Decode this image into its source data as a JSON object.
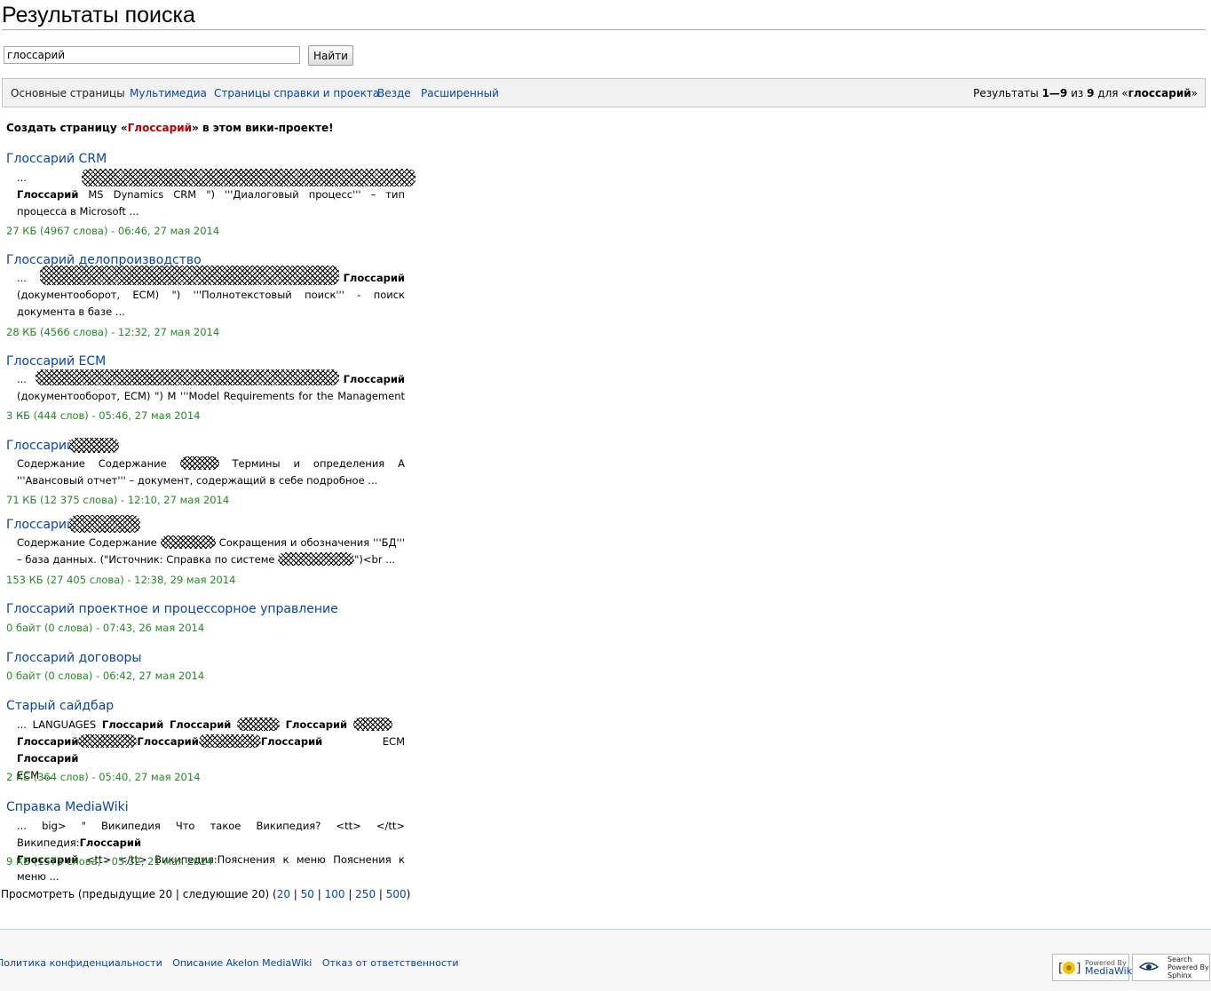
{
  "page": {
    "title": "Результаты поиска"
  },
  "search": {
    "value": "глоссарий",
    "button": "Найти"
  },
  "tabs": {
    "items": [
      "Основные страницы",
      "Мультимедиа",
      "Страницы справки и проекта",
      "Везде",
      "Расширенный"
    ],
    "info_prefix": "Результаты ",
    "info_range": "1—9",
    "info_mid": " из ",
    "info_total": "9",
    "info_for": " для «",
    "info_term": "глоссарий",
    "info_end": "»"
  },
  "create": {
    "prefix": "Создать страницу «",
    "link": "Глоссарий",
    "suffix": "» в этом вики-проекте!"
  },
  "results": [
    {
      "title": "Глоссарий CRM",
      "s1": "...",
      "s2_bold": "Глоссарий",
      "s2": " MS Dynamics CRM \") '''Диалоговый процесс''' – тип процесса в Microsoft ...",
      "meta": "27 КБ (4967 слова) - 06:46, 27 мая 2014"
    },
    {
      "title": "Глоссарий делопроизводство",
      "s1": "...",
      "s1_bold": "Глоссарий",
      "s2": "(документооборот, ECM) \") '''Полнотекстовый поиск''' - поиск документа в базе ...",
      "meta": "28 КБ (4566 слова) - 12:32, 27 мая 2014"
    },
    {
      "title": "Глоссарий ECM",
      "s1": "...",
      "s1_bold": "Глоссарий",
      "s2": "(документооборот, ECM) \") M '''Model Requirements for the Management ...",
      "meta": "3 КБ (444 слов) - 05:46, 27 мая 2014"
    },
    {
      "title": "Глоссарий",
      "s1a": "Содержание Содержание ",
      "s1b": " Термины и определения А '''Авансовый отчет''' – документ, содержащий в себе подробное ...",
      "meta": "71 КБ (12 375 слова) - 12:10, 27 мая 2014"
    },
    {
      "title": "Глоссарий",
      "s1a": "Содержание Содержание ",
      "s1b": " Сокращения и обозначения '''БД''' – база данных. (\"Источник: Справка по системе ",
      "s1c": "\")<br ...",
      "meta": "153 КБ (27 405 слова) - 12:38, 29 мая 2014"
    },
    {
      "title": "Глоссарий проектное и процессорное управление",
      "meta": "0 байт (0 слова) - 07:43, 26 мая 2014"
    },
    {
      "title": "Глоссарий договоры",
      "meta": "0 байт (0 слова) - 06:42, 27 мая 2014"
    },
    {
      "title": "Старый сайдбар",
      "s1": "... LANGUAGES ",
      "b1": "Глоссарий",
      "b2": "Глоссарий",
      "b3": "Глоссарий",
      "b4": "Глоссарий",
      "b5": "Глоссарий",
      "b6": "Глоссарий",
      "t_ecm": " ECM ",
      "b7": "Глоссарий",
      "tail": " ECM ...",
      "meta": "2 КБ (364 слов) - 05:40, 27 мая 2014"
    },
    {
      "title": "Справка MediaWiki",
      "s1": "... big> \" Википедия Что такое Википедия? <tt> </tt> Википедия:",
      "b1": "Глоссарий",
      "b2": "Глоссарий",
      "s2": " <tt> </tt> Википедия:Пояснения к меню Пояснения к меню ...",
      "meta": "9 КБ (1575 слова) - 05:32, 21 мая 2014"
    }
  ],
  "pager": {
    "prefix": "Просмотреть (предыдущие 20 | следующие 20) (",
    "options": [
      "20",
      "50",
      "100",
      "250",
      "500"
    ],
    "sep": " | ",
    "suffix": ")"
  },
  "footer": {
    "links": [
      "Политика конфиденциальности",
      "Описание Akelon MediaWiki",
      "Отказ от ответственности"
    ],
    "badge_mw_top": "Powered By",
    "badge_mw_main": "MediaWiki",
    "badge_sphinx": [
      "Search",
      "Powered By",
      "Sphinx"
    ]
  },
  "colors": {
    "link": "#0645ad",
    "redlink": "#ba0000",
    "meta": "#228b22"
  }
}
